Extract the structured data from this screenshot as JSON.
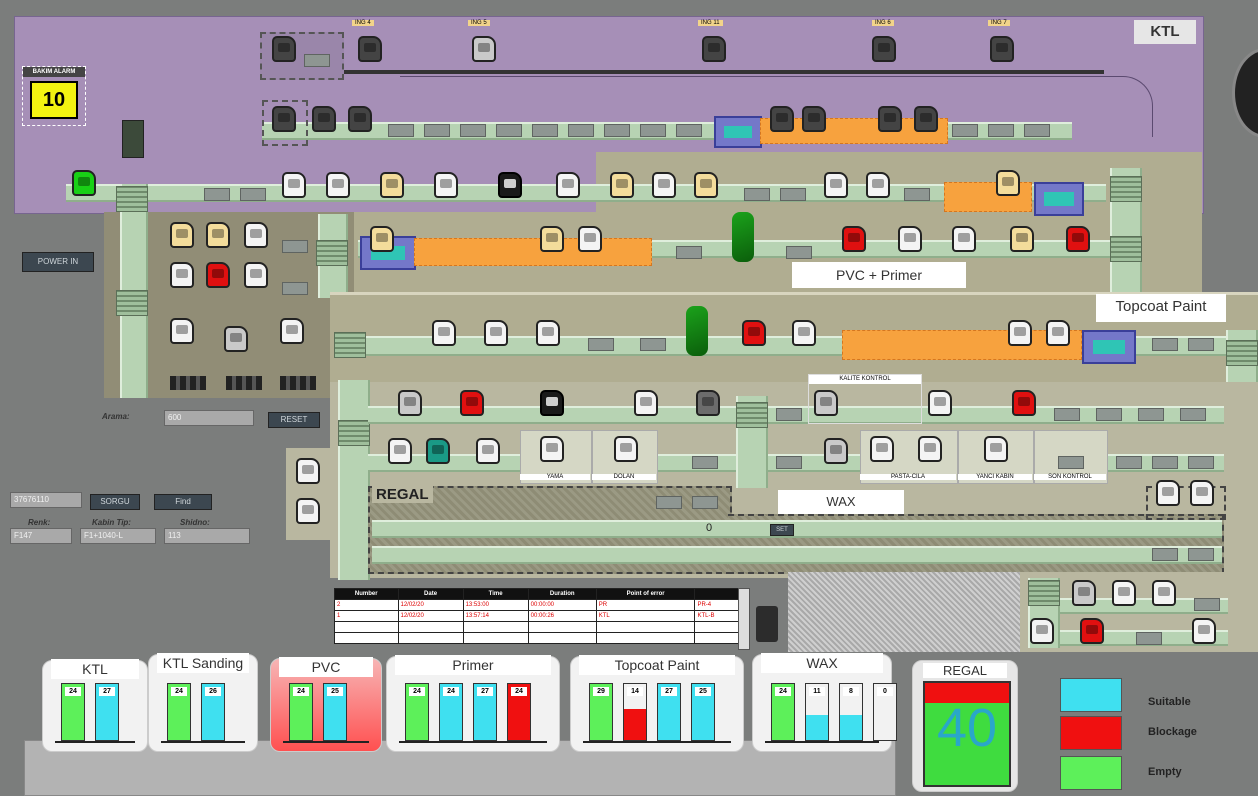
{
  "colors": {
    "suitable": "#3fe0f0",
    "blockage": "#f01010",
    "empty": "#5df05a",
    "ktl_zone": "#a68fb7",
    "paint_zone": "#b0ad91",
    "dark_zone": "#918d76"
  },
  "ktl": {
    "title": "KTL",
    "alarm_title": "BAKIM ALARM",
    "alarm_value": "10",
    "stations": [
      "ING 4",
      "ING 5",
      "ING 11",
      "ING 6",
      "ING 7"
    ]
  },
  "zones": {
    "pvc_primer": "PVC + Primer",
    "topcoat": "Topcoat Paint",
    "regal": "REGAL",
    "wax": "WAX",
    "kalite": "KALITE KONTROL"
  },
  "stations": {
    "s1": "YAMA",
    "s2": "DOLAN",
    "s3": "PASTA-CILA",
    "s4": "YANCI KABIN",
    "s5": "SON KONTROL"
  },
  "regal_track": {
    "count": "0",
    "btn": "SET"
  },
  "controls": {
    "power": "POWER IN",
    "search_label": "Arama:",
    "search_value": "600",
    "reset": "RESET",
    "serial_value": "37676110",
    "sorgu": "SORGU",
    "find": "Find",
    "renk_label": "Renk:",
    "renk_value": "F147",
    "kabin_label": "Kabin Tip:",
    "kabin_value": "F1+1040-L",
    "shidno_label": "Shidno:",
    "shidno_value": "113"
  },
  "error_table": {
    "headers": [
      "Number",
      "Date",
      "Time",
      "Duration",
      "Point of error",
      ""
    ],
    "rows": [
      [
        "2",
        "12/02/20",
        "13:53:00",
        "00:00:00",
        "PR",
        "PR-4"
      ],
      [
        "1",
        "12/02/20",
        "13:57:14",
        "00:00:26",
        "KTL",
        "KTL-B"
      ],
      [
        "",
        "",
        "",
        "",
        "",
        ""
      ],
      [
        "",
        "",
        "",
        "",
        "",
        ""
      ]
    ]
  },
  "bottom_panels": [
    {
      "title": "KTL",
      "bars": [
        {
          "v": "24",
          "c": "empty"
        },
        {
          "v": "27",
          "c": "suitable"
        }
      ]
    },
    {
      "title": "KTL Sanding",
      "bars": [
        {
          "v": "24",
          "c": "empty"
        },
        {
          "v": "26",
          "c": "suitable"
        }
      ]
    },
    {
      "title": "PVC",
      "bars": [
        {
          "v": "24",
          "c": "empty"
        },
        {
          "v": "25",
          "c": "suitable"
        }
      ]
    },
    {
      "title": "Primer",
      "bars": [
        {
          "v": "24",
          "c": "empty"
        },
        {
          "v": "24",
          "c": "suitable"
        },
        {
          "v": "27",
          "c": "suitable"
        },
        {
          "v": "24",
          "c": "blockage"
        }
      ]
    },
    {
      "title": "Topcoat Paint",
      "bars": [
        {
          "v": "29",
          "c": "empty"
        },
        {
          "v": "14",
          "c": "split"
        },
        {
          "v": "27",
          "c": "suitable"
        },
        {
          "v": "25",
          "c": "suitable"
        }
      ]
    },
    {
      "title": "WAX",
      "bars": [
        {
          "v": "24",
          "c": "empty"
        },
        {
          "v": "11",
          "c": "lowfill"
        },
        {
          "v": "8",
          "c": "lowfill"
        },
        {
          "v": "0",
          "c": "emptygray"
        }
      ]
    }
  ],
  "regal_panel": {
    "title": "REGAL",
    "value": "40"
  },
  "legend": [
    {
      "label": "Suitable",
      "color": "#3fe0f0"
    },
    {
      "label": "Blockage",
      "color": "#f01010"
    },
    {
      "label": "Empty",
      "color": "#5df05a"
    }
  ]
}
